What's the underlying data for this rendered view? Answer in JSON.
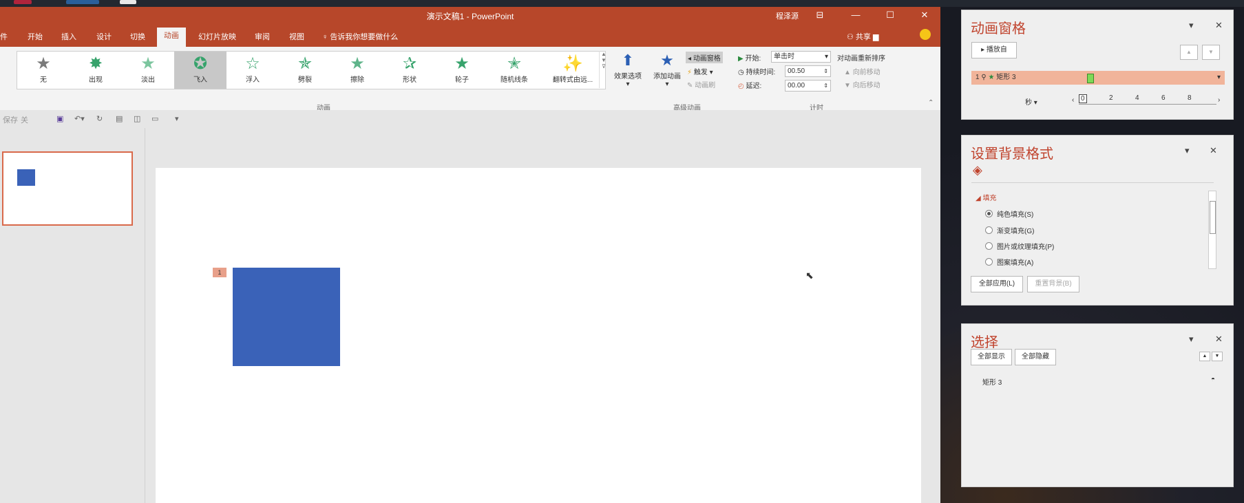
{
  "window": {
    "title": "演示文稿1  -  PowerPoint",
    "user": "程泽源",
    "controls": [
      "⊟",
      "—",
      "☐",
      "✕"
    ]
  },
  "menu": {
    "tabs": [
      "件",
      "开始",
      "插入",
      "设计",
      "切换",
      "动画",
      "幻灯片放映",
      "审阅",
      "视图"
    ],
    "active_tab": "动画",
    "tell_me": "告诉我你想要做什么",
    "share": "共享"
  },
  "ribbon": {
    "animations": [
      {
        "label": "无",
        "icon": "star-gray-icon"
      },
      {
        "label": "出现",
        "icon": "star-appear-icon"
      },
      {
        "label": "淡出",
        "icon": "star-fade-icon"
      },
      {
        "label": "飞入",
        "icon": "star-flyin-icon",
        "selected": true
      },
      {
        "label": "浮入",
        "icon": "star-float-icon"
      },
      {
        "label": "劈裂",
        "icon": "star-split-icon"
      },
      {
        "label": "擦除",
        "icon": "star-wipe-icon"
      },
      {
        "label": "形状",
        "icon": "star-shape-icon"
      },
      {
        "label": "轮子",
        "icon": "star-wheel-icon"
      },
      {
        "label": "随机线条",
        "icon": "star-randombars-icon"
      },
      {
        "label": "翻转式由远...",
        "icon": "star-growturn-icon"
      }
    ],
    "effect_options": "效果选项",
    "group_animation": "动画",
    "add_animation": "添加动画",
    "animation_pane": "动画窗格",
    "trigger": "触发",
    "animation_painter": "动画刷",
    "group_advanced": "高级动画",
    "start_label": "开始:",
    "start_value": "单击时",
    "duration_label": "持续时间:",
    "duration_value": "00.50",
    "delay_label": "延迟:",
    "delay_value": "00.00",
    "group_timing": "计时",
    "reorder_title": "对动画重新排序",
    "move_earlier": "向前移动",
    "move_later": "向后移动"
  },
  "qat": {
    "autosave": "保存",
    "autosave_state": "关"
  },
  "slide": {
    "anim_tag": "1"
  },
  "animation_pane": {
    "title": "动画窗格",
    "play": "播放自",
    "item_index": "1",
    "item_label": "矩形 3",
    "time_unit": "秒",
    "ticks": [
      "0",
      "2",
      "4",
      "6",
      "8"
    ]
  },
  "background_pane": {
    "title": "设置背景格式",
    "section": "填充",
    "options": [
      "纯色填充(S)",
      "渐变填充(G)",
      "图片或纹理填充(P)",
      "图案填充(A)"
    ],
    "selected_option": 0,
    "apply_all": "全部应用(L)",
    "reset": "重置背景(B)"
  },
  "selection_pane": {
    "title": "选择",
    "show_all": "全部显示",
    "hide_all": "全部隐藏",
    "item": "矩形 3"
  },
  "colors": {
    "accent": "#b7472a",
    "shape": "#3a62b8",
    "pane_title": "#c0432d",
    "selected_anim": "#f1b49a"
  }
}
